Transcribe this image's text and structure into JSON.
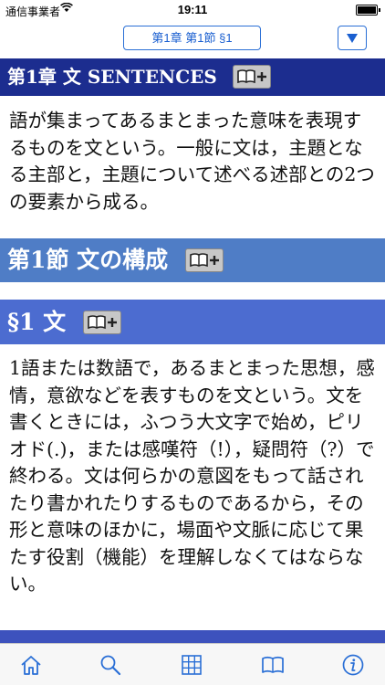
{
  "status_bar": {
    "carrier": "通信事業者",
    "time": "19:11"
  },
  "nav": {
    "section_selector_label": "第1章 第1節 §1"
  },
  "chapter_heading": {
    "label": "第1章 文 SENTENCES"
  },
  "chapter_text": "語が集まってあるまとまった意味を表現するものを文という。一般に文は，主題となる主部と，主題について述べる述部との2つの要素から成る。",
  "section_heading": {
    "label": "第1節 文の構成"
  },
  "paragraph_heading": {
    "label": "§1 文"
  },
  "paragraph_text": "1語または数語で，あるまとまった思想，感情，意欲などを表すものを文という。文を書くときには，ふつう大文字で始め，ピリオド(.)，または感嘆符（!），疑問符（?）で終わる。文は何らかの意図をもって話されたり書かれたりするものであるから，その形と意味のほかに，場面や文脈に応じて果たす役割（機能）を理解しなくてはならない。",
  "colors": {
    "chapter_heading_bg": "#1c2d8f",
    "section_heading_bg": "#4f7dc6",
    "paragraph_heading_bg": "#4c6cd0",
    "accent": "#2a6fd6"
  },
  "tab_bar": {
    "icons": [
      "home-icon",
      "search-icon",
      "grid-icon",
      "book-icon",
      "info-icon"
    ]
  }
}
